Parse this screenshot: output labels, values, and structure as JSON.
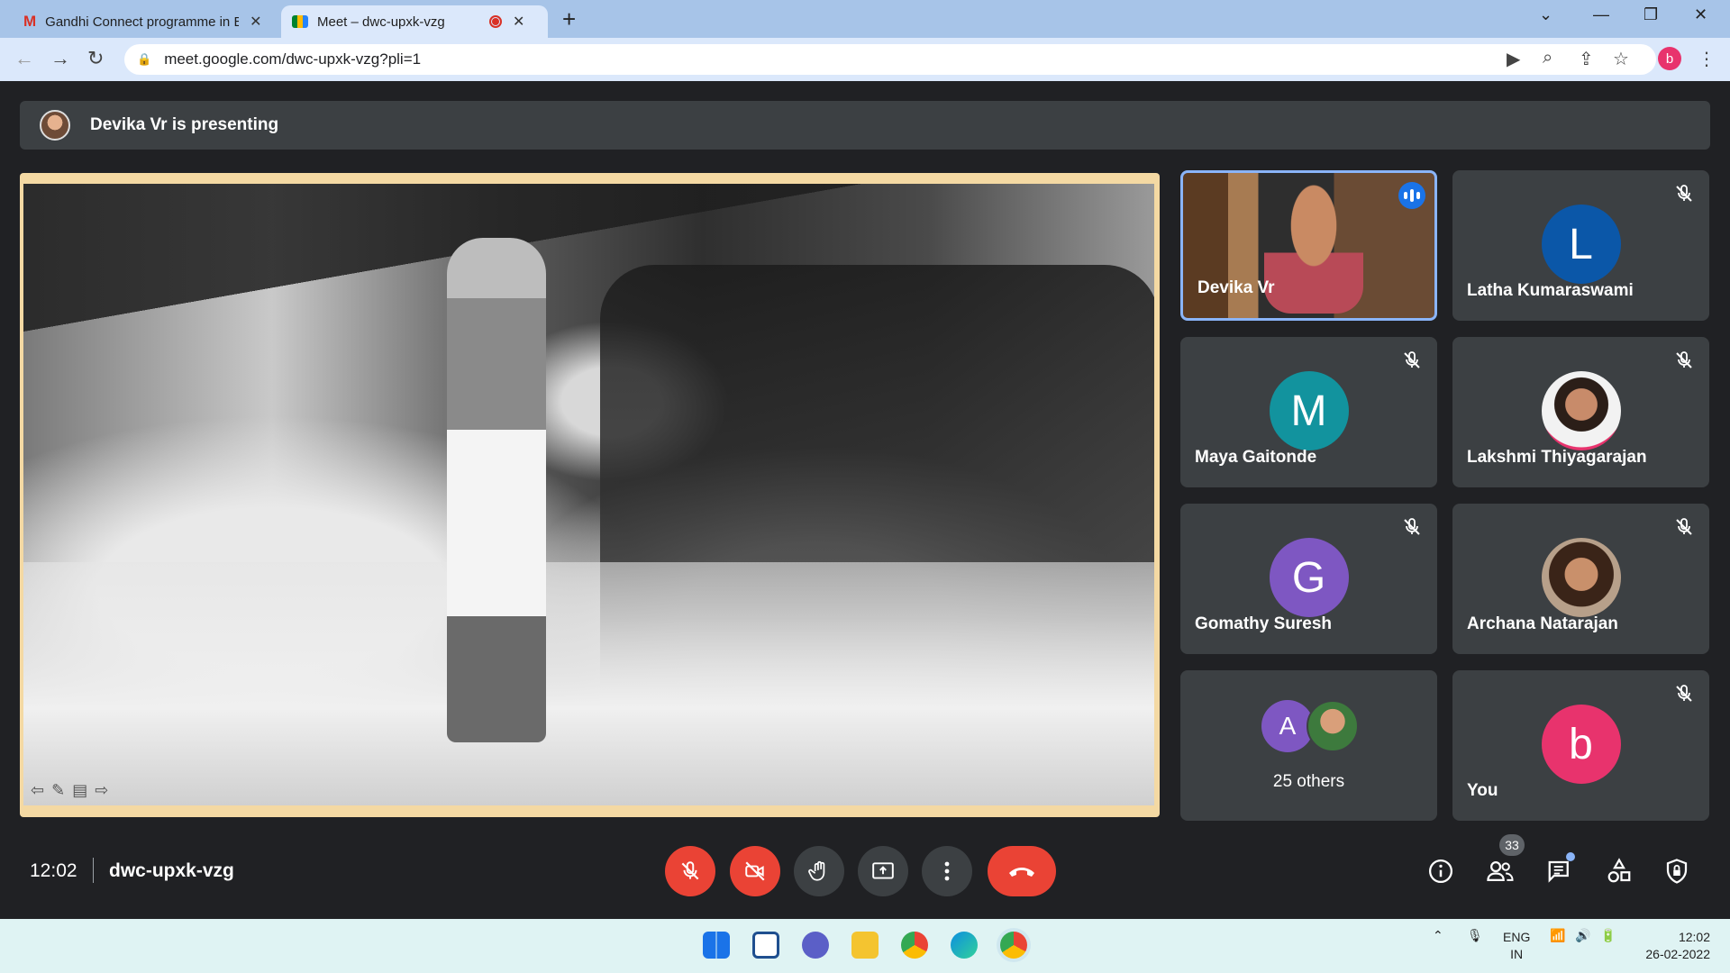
{
  "browser": {
    "tabs": [
      {
        "title": "Gandhi Connect programme in B",
        "favicon": "gmail-icon"
      },
      {
        "title": "Meet – dwc-upxk-vzg",
        "favicon": "meet-icon",
        "recording": true
      }
    ],
    "url": "meet.google.com/dwc-upxk-vzg?pli=1",
    "profile_initial": "b"
  },
  "meet": {
    "presenting_text": "Devika Vr is presenting",
    "participants": [
      {
        "name": "Devika Vr",
        "speaking": true
      },
      {
        "name": "Latha Kumaraswami",
        "initial": "L",
        "color": "#0b57a8",
        "muted": true
      },
      {
        "name": "Maya Gaitonde",
        "initial": "M",
        "color": "#12939e",
        "muted": true
      },
      {
        "name": "Lakshmi Thiyagarajan",
        "muted": true
      },
      {
        "name": "Gomathy Suresh",
        "initial": "G",
        "color": "#7e57c2",
        "muted": true
      },
      {
        "name": "Archana Natarajan",
        "muted": true
      },
      {
        "name": "25 others",
        "initial": "A"
      },
      {
        "name": "You",
        "initial": "b",
        "color": "#e8336d",
        "muted": true
      }
    ],
    "clock": "12:02",
    "meeting_code": "dwc-upxk-vzg",
    "people_count": "33"
  },
  "taskbar": {
    "lang_line1": "ENG",
    "lang_line2": "IN",
    "time": "12:02",
    "date": "26-02-2022"
  },
  "colors": {
    "accent": "#8ab4f8",
    "danger": "#ea4335",
    "tile": "#3c4043"
  }
}
